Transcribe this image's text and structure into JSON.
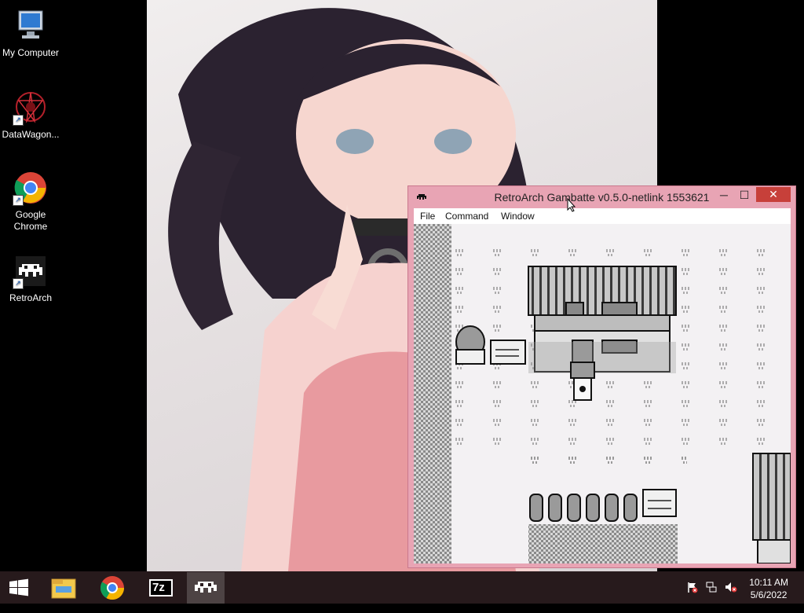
{
  "desktop": {
    "icons": [
      {
        "label": "My Computer",
        "icon": "computer-icon"
      },
      {
        "label": "DataWagon...",
        "icon": "datawagon-icon"
      },
      {
        "label": "Google Chrome",
        "icon": "chrome-icon"
      },
      {
        "label": "RetroArch",
        "icon": "retroarch-icon"
      }
    ]
  },
  "window": {
    "title": "RetroArch Gambatte v0.5.0-netlink 1553621",
    "minimize": "─",
    "maximize": "☐",
    "close": "✕",
    "menu": [
      "File",
      "Command",
      "Window"
    ],
    "accent": "#e8a4b4",
    "close_color": "#c7403a"
  },
  "taskbar": {
    "start_icon": "windows-start-icon",
    "pinned": [
      "file-explorer-icon",
      "chrome-icon",
      "7zip-icon",
      "retroarch-icon"
    ],
    "seven_zip_label": "7z",
    "tray_icons": [
      "action-center-flag-icon",
      "network-icon",
      "volume-muted-icon"
    ],
    "time": "10:11 AM",
    "date": "5/6/2022"
  }
}
